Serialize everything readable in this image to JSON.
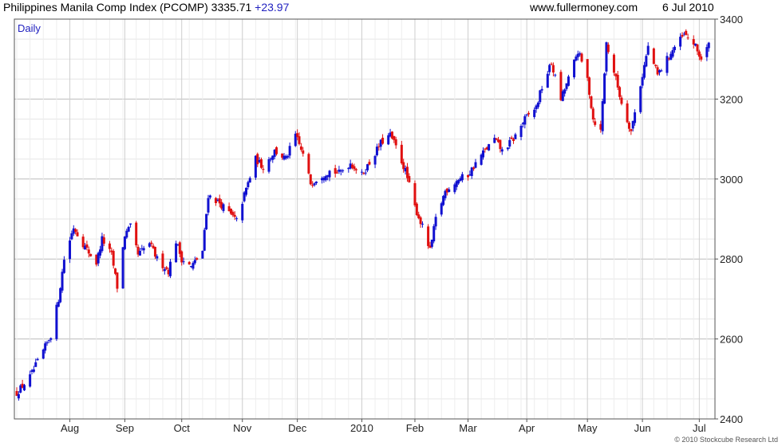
{
  "header": {
    "title": "Philippines Manila Comp Index (PCOMP)",
    "last_value": "3335.71",
    "change": "+23.97",
    "site": "www.fullermoney.com",
    "date": "6 Jul 2010"
  },
  "copyright": "© 2010 Stockcube Research Ltd",
  "colors": {
    "up": "#1010d0",
    "down": "#e01010",
    "grid": "#cccccc",
    "frame": "#555555"
  },
  "chart_data": {
    "type": "candlestick",
    "period_label": "Daily",
    "ylim": [
      2400,
      3400
    ],
    "y_ticks": [
      2400,
      2600,
      2800,
      3000,
      3200,
      3400
    ],
    "x_tick_labels": [
      "Aug",
      "Sep",
      "Oct",
      "Nov",
      "Dec",
      "2010",
      "Feb",
      "Mar",
      "Apr",
      "May",
      "Jun",
      "Jul"
    ],
    "x_tick_dates": [
      "2009-08-03",
      "2009-09-01",
      "2009-10-01",
      "2009-11-02",
      "2009-12-01",
      "2010-01-04",
      "2010-02-01",
      "2010-03-01",
      "2010-04-01",
      "2010-05-03",
      "2010-06-01",
      "2010-07-01"
    ],
    "x_start": "2009-07-06",
    "x_end": "2010-07-08",
    "close_path": [
      [
        "2009-07-06",
        2465
      ],
      [
        "2009-07-13",
        2505
      ],
      [
        "2009-07-20",
        2570
      ],
      [
        "2009-07-24",
        2610
      ],
      [
        "2009-07-28",
        2700
      ],
      [
        "2009-07-31",
        2800
      ],
      [
        "2009-08-05",
        2880
      ],
      [
        "2009-08-11",
        2830
      ],
      [
        "2009-08-17",
        2790
      ],
      [
        "2009-08-20",
        2850
      ],
      [
        "2009-08-25",
        2810
      ],
      [
        "2009-08-28",
        2730
      ],
      [
        "2009-09-01",
        2860
      ],
      [
        "2009-09-04",
        2880
      ],
      [
        "2009-09-08",
        2810
      ],
      [
        "2009-09-14",
        2840
      ],
      [
        "2009-09-18",
        2800
      ],
      [
        "2009-09-24",
        2770
      ],
      [
        "2009-09-28",
        2845
      ],
      [
        "2009-10-01",
        2800
      ],
      [
        "2009-10-06",
        2780
      ],
      [
        "2009-10-12",
        2820
      ],
      [
        "2009-10-15",
        2960
      ],
      [
        "2009-10-21",
        2940
      ],
      [
        "2009-10-27",
        2910
      ],
      [
        "2009-10-30",
        2895
      ],
      [
        "2009-11-03",
        2960
      ],
      [
        "2009-11-09",
        3050
      ],
      [
        "2009-11-13",
        3030
      ],
      [
        "2009-11-19",
        3070
      ],
      [
        "2009-11-25",
        3050
      ],
      [
        "2009-11-30",
        3110
      ],
      [
        "2009-12-04",
        3060
      ],
      [
        "2009-12-08",
        2990
      ],
      [
        "2009-12-14",
        3010
      ],
      [
        "2009-12-18",
        3020
      ],
      [
        "2009-12-23",
        3015
      ],
      [
        "2009-12-29",
        3040
      ],
      [
        "2010-01-04",
        3010
      ],
      [
        "2010-01-08",
        3040
      ],
      [
        "2010-01-14",
        3090
      ],
      [
        "2010-01-19",
        3110
      ],
      [
        "2010-01-22",
        3080
      ],
      [
        "2010-01-27",
        3020
      ],
      [
        "2010-02-01",
        2930
      ],
      [
        "2010-02-05",
        2880
      ],
      [
        "2010-02-09",
        2820
      ],
      [
        "2010-02-12",
        2900
      ],
      [
        "2010-02-17",
        2970
      ],
      [
        "2010-02-24",
        3000
      ],
      [
        "2010-03-01",
        3010
      ],
      [
        "2010-03-08",
        3060
      ],
      [
        "2010-03-15",
        3100
      ],
      [
        "2010-03-19",
        3070
      ],
      [
        "2010-03-25",
        3100
      ],
      [
        "2010-03-31",
        3150
      ],
      [
        "2010-04-06",
        3180
      ],
      [
        "2010-04-09",
        3230
      ],
      [
        "2010-04-14",
        3290
      ],
      [
        "2010-04-19",
        3200
      ],
      [
        "2010-04-23",
        3250
      ],
      [
        "2010-04-28",
        3320
      ],
      [
        "2010-05-03",
        3250
      ],
      [
        "2010-05-06",
        3150
      ],
      [
        "2010-05-10",
        3120
      ],
      [
        "2010-05-13",
        3340
      ],
      [
        "2010-05-18",
        3250
      ],
      [
        "2010-05-21",
        3190
      ],
      [
        "2010-05-26",
        3120
      ],
      [
        "2010-06-01",
        3260
      ],
      [
        "2010-06-04",
        3330
      ],
      [
        "2010-06-09",
        3260
      ],
      [
        "2010-06-14",
        3300
      ],
      [
        "2010-06-18",
        3330
      ],
      [
        "2010-06-23",
        3360
      ],
      [
        "2010-06-28",
        3340
      ],
      [
        "2010-07-02",
        3300
      ],
      [
        "2010-07-06",
        3335
      ]
    ]
  }
}
